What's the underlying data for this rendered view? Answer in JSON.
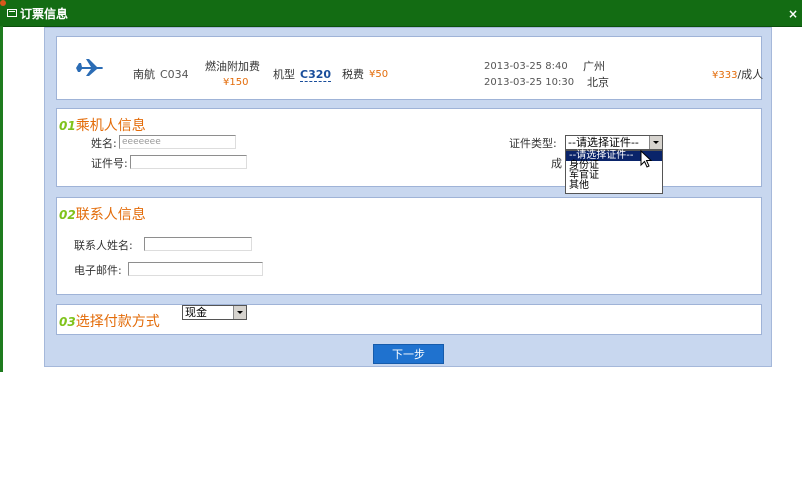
{
  "window": {
    "title": "订票信息",
    "close_label": "×"
  },
  "flight": {
    "airline": "南航",
    "flight_no": "C034",
    "fuel_label": "燃油附加费",
    "fuel_price": "¥150",
    "aircraft_label": "机型",
    "aircraft": "C320",
    "tax_label": "税费",
    "tax_price": "¥50",
    "depart_time": "2013-03-25 8:40",
    "depart_city": "广州",
    "arrive_time": "2013-03-25 10:30",
    "arrive_city": "北京",
    "price": "¥333",
    "price_unit": "/成人"
  },
  "passenger": {
    "num": "01",
    "title": "乘机人信息",
    "name_label": "姓名:",
    "name_value": "eeeeeee",
    "id_label": "证件号:",
    "id_value": "",
    "idtype_label": "证件类型:",
    "idtype_selected": "--请选择证件--",
    "idtype_options": [
      "--请选择证件--",
      "身份证",
      "军官证",
      "其他"
    ],
    "partial_label": "成"
  },
  "contact": {
    "num": "02",
    "title": "联系人信息",
    "name_label": "联系人姓名:",
    "email_label": "电子邮件:"
  },
  "payment": {
    "num": "03",
    "title": "选择付款方式",
    "method_selected": "现金"
  },
  "next_button": "下一步",
  "colors": {
    "titlebar": "#136c13",
    "accent": "#e36c0a",
    "number": "#7fc31c",
    "button": "#1f72cf"
  }
}
